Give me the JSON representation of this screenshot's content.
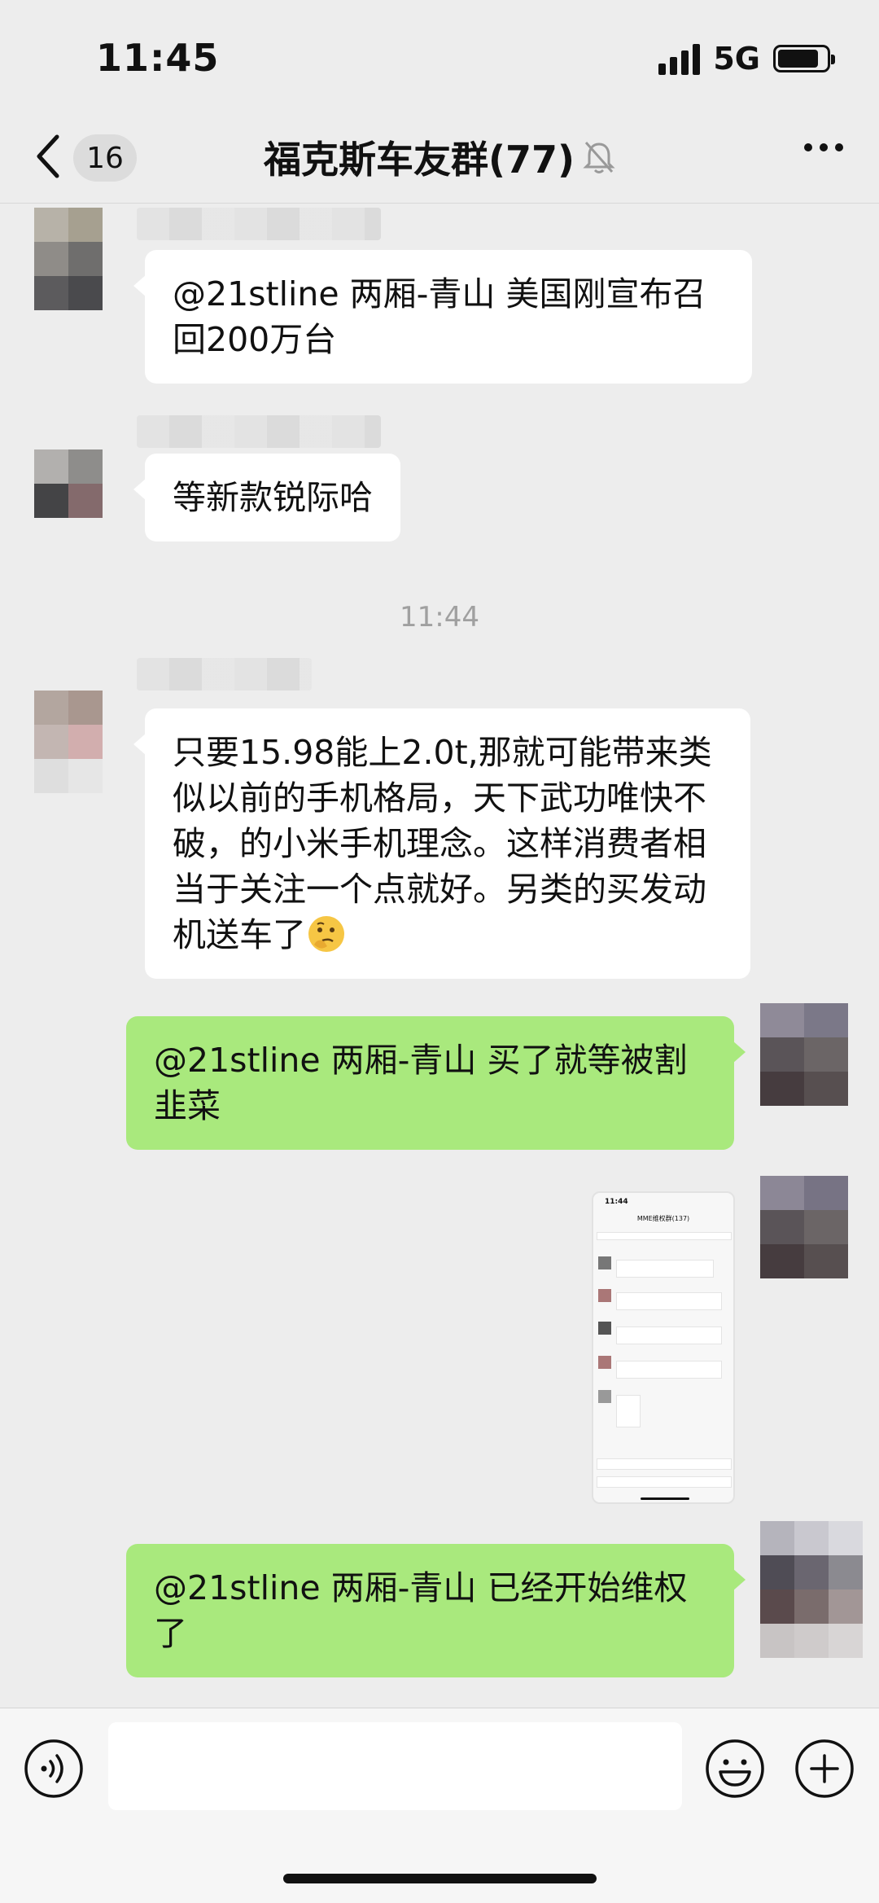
{
  "status_bar": {
    "time": "11:45",
    "network": "5G",
    "battery_level": 0.85
  },
  "nav": {
    "unread_count": "16",
    "title": "福克斯车友群(77)"
  },
  "messages": [
    {
      "side": "left",
      "text": "@21stline 两厢-青山 美国刚宣布召回200万台"
    },
    {
      "side": "left",
      "text": "等新款锐际哈"
    },
    {
      "side": "left",
      "text": "只要15.98能上2.0t,那就可能带来类似以前的手机格局，天下武功唯快不破，的小米手机理念。这样消费者相当于关注一个点就好。另类的买发动机送车了",
      "emoji": "thinking-face"
    },
    {
      "side": "right",
      "text": "@21stline 两厢-青山 买了就等被割韭菜"
    },
    {
      "side": "right",
      "type": "image",
      "thumb_time": "11:44",
      "thumb_title": "MME维权群(137)"
    },
    {
      "side": "right",
      "text": "@21stline 两厢-青山 已经开始维权了"
    }
  ],
  "time_divider": "11:44",
  "colors": {
    "bubble_self": "#a9e97d",
    "bubble_other": "#ffffff",
    "background": "#ededed"
  },
  "icons": [
    "back-chevron",
    "mute-bell",
    "more-dots",
    "voice",
    "emoji",
    "plus"
  ]
}
